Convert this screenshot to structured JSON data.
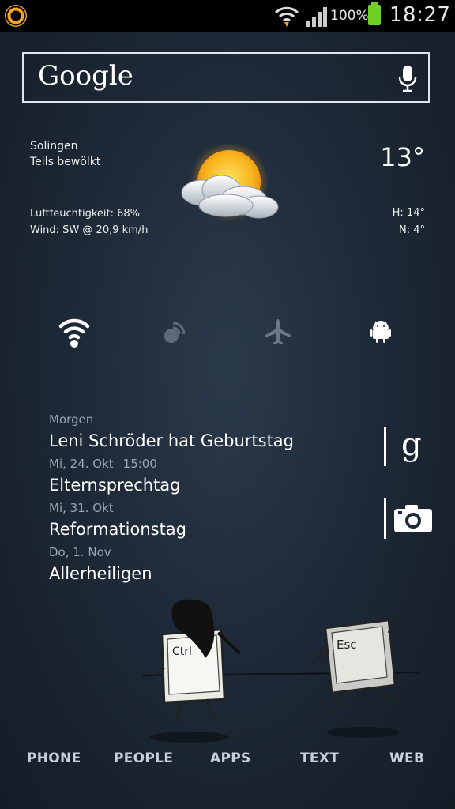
{
  "status_bar": {
    "battery": "100%",
    "time": "18:27",
    "icons": [
      "app-notification-icon",
      "wifi-icon",
      "signal-icon",
      "battery-icon"
    ]
  },
  "search": {
    "logo": "Google",
    "icon": "mic-icon"
  },
  "weather": {
    "city": "Solingen",
    "condition": "Teils bewölkt",
    "humidity": "Luftfeuchtigkeit: 68%",
    "wind": "Wind: SW @ 20,9 km/h",
    "temp": "13°",
    "high": "H:   14°",
    "low": "N:    4°",
    "icon": "partly-cloudy-icon"
  },
  "toggles": [
    {
      "icon": "wifi-icon",
      "state": "on"
    },
    {
      "icon": "sync-icon",
      "state": "off"
    },
    {
      "icon": "airplane-icon",
      "state": "off"
    },
    {
      "icon": "android-icon",
      "state": "on"
    }
  ],
  "calendar": {
    "entries": [
      {
        "date": "Morgen",
        "time": "",
        "title": "Leni Schröder hat Geburtstag"
      },
      {
        "date": "Mi, 24. Okt",
        "time": "15:00",
        "title": "Elternsprechtag"
      },
      {
        "date": "Mi, 31. Okt",
        "time": "",
        "title": "Reformationstag"
      },
      {
        "date": "Do, 1. Nov",
        "time": "",
        "title": "Allerheiligen"
      }
    ]
  },
  "side_shortcuts": [
    {
      "icon": "google-g-icon"
    },
    {
      "icon": "camera-icon"
    }
  ],
  "wallpaper_keys": {
    "ctrl": "Ctrl",
    "esc": "Esc"
  },
  "dock": [
    "PHONE",
    "PEOPLE",
    "APPS",
    "TEXT",
    "WEB"
  ],
  "colors": {
    "battery": "#6fcf24",
    "sun": "#f7b21c",
    "background": "#1e2a38"
  }
}
